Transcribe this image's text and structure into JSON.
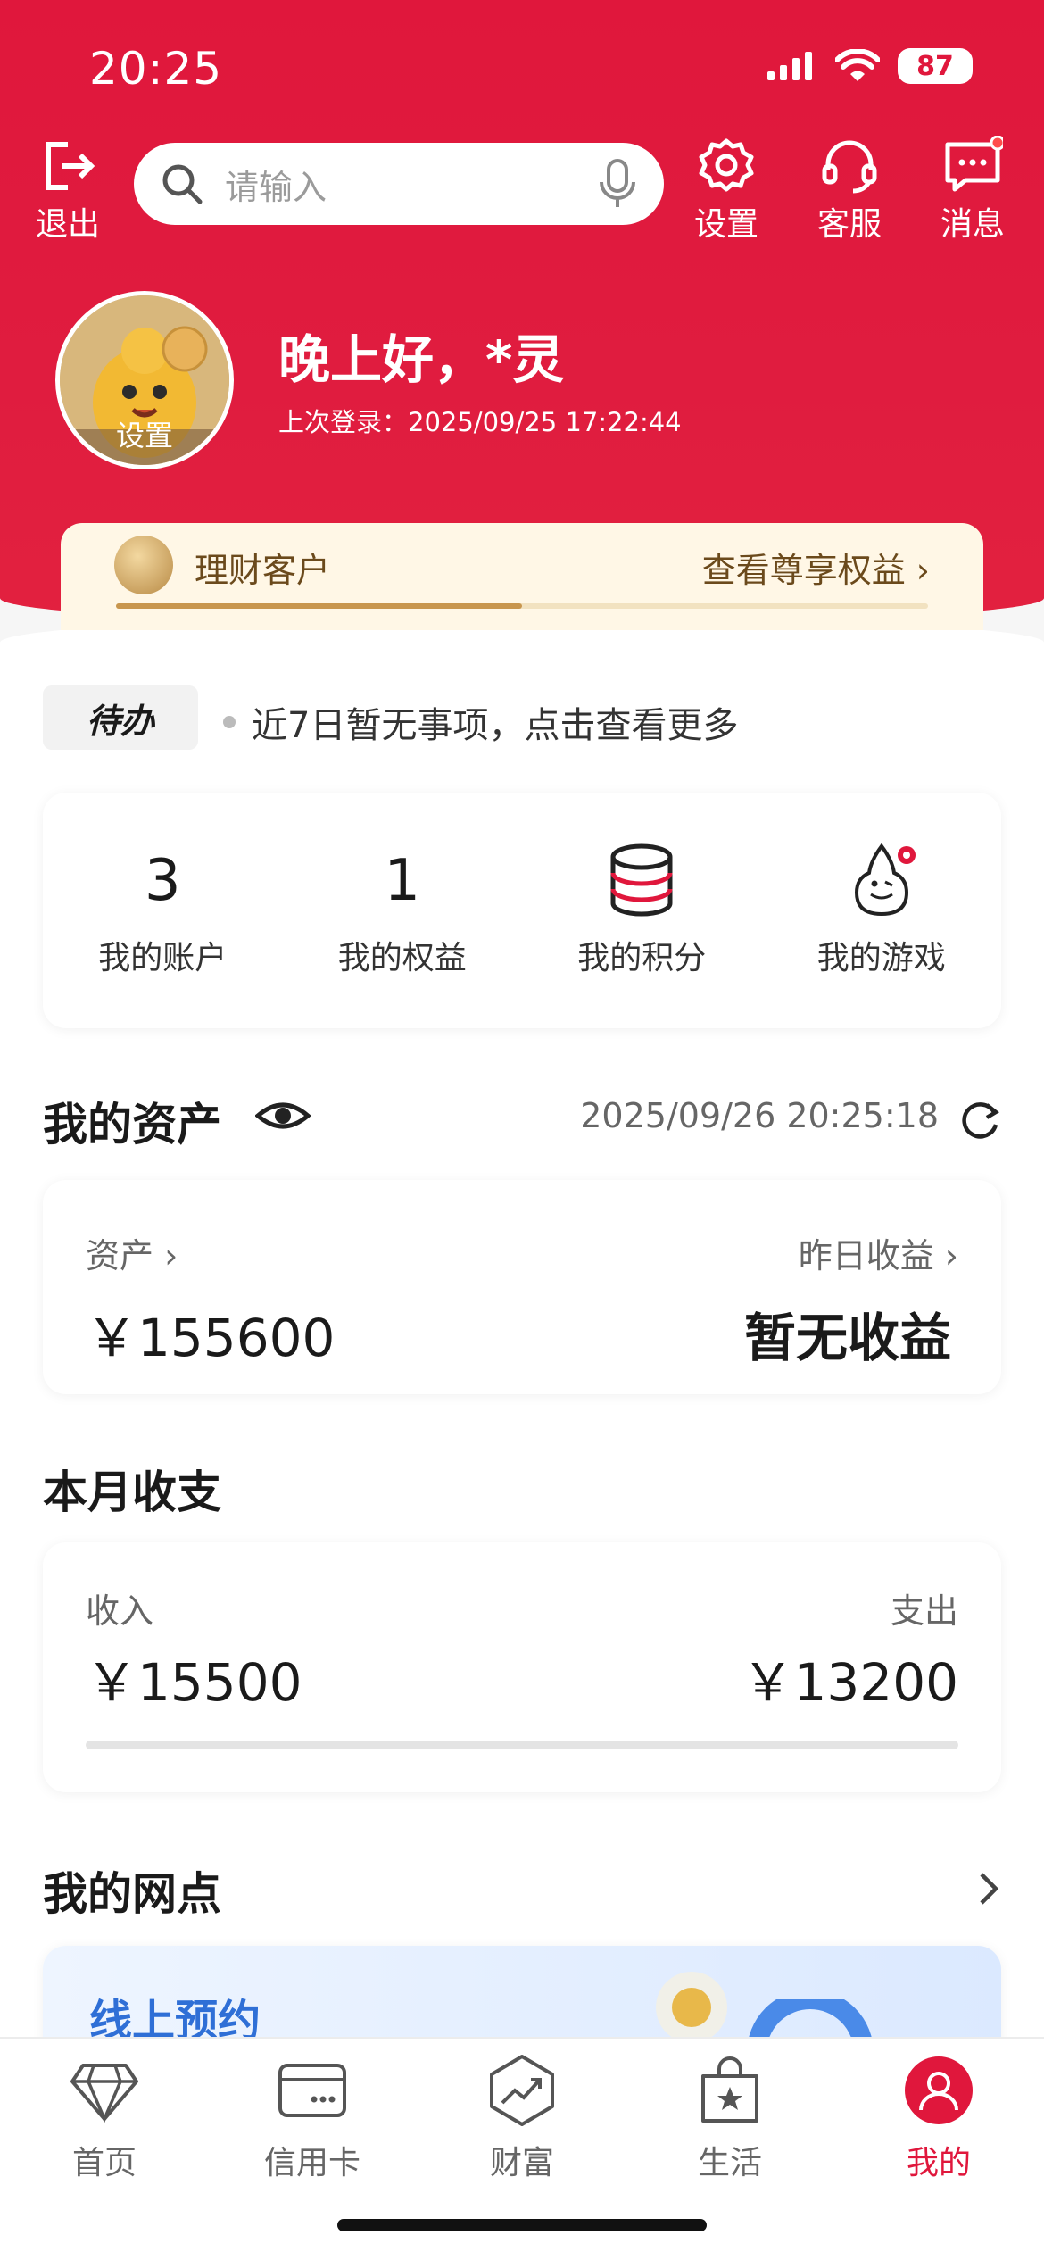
{
  "status_bar": {
    "time": "20:25",
    "battery": "87"
  },
  "header": {
    "exit_label": "退出",
    "search_placeholder": "请输入",
    "settings_label": "设置",
    "service_label": "客服",
    "messages_label": "消息"
  },
  "profile": {
    "avatar_label": "设置",
    "greeting": "晚上好，*灵",
    "last_login": "上次登录：2025/09/25 17:22:44"
  },
  "vip": {
    "level": "理财客户",
    "link": "查看尊享权益",
    "progress": 0.5
  },
  "todo": {
    "tag": "待办",
    "text": "近7日暂无事项，点击查看更多"
  },
  "quick_stats": [
    {
      "value": "3",
      "label": "我的账户"
    },
    {
      "value": "1",
      "label": "我的权益"
    },
    {
      "icon": "database-icon",
      "label": "我的积分"
    },
    {
      "icon": "mascot-icon",
      "label": "我的游戏"
    }
  ],
  "assets": {
    "title": "我的资产",
    "timestamp": "2025/09/26 20:25:18",
    "asset_label": "资产",
    "asset_value": "￥155600",
    "yesterday_label": "昨日收益",
    "yesterday_value": "暂无收益"
  },
  "monthly": {
    "title": "本月收支",
    "income_label": "收入",
    "income_value": "￥15500",
    "expense_label": "支出",
    "expense_value": "￥13200"
  },
  "branch": {
    "title": "我的网点",
    "card_title": "线上预约"
  },
  "tabbar": [
    {
      "label": "首页",
      "icon": "diamond-icon"
    },
    {
      "label": "信用卡",
      "icon": "card-icon"
    },
    {
      "label": "财富",
      "icon": "chart-icon"
    },
    {
      "label": "生活",
      "icon": "bag-icon"
    },
    {
      "label": "我的",
      "icon": "user-icon",
      "active": true
    }
  ],
  "colors": {
    "brand": "#e0173c",
    "vip_bg": "#fff7e6",
    "link_blue": "#2f6fd6"
  }
}
